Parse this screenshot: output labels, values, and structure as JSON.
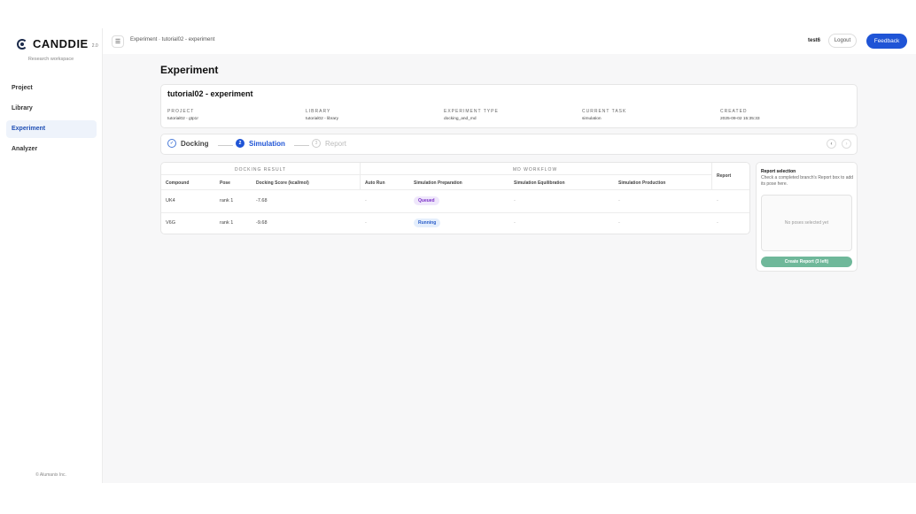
{
  "brand": {
    "name": "CANDDIE",
    "version": "2.0",
    "subtitle": "Research workspace"
  },
  "sidebar": {
    "items": [
      {
        "label": "Project"
      },
      {
        "label": "Library"
      },
      {
        "label": "Experiment"
      },
      {
        "label": "Analyzer"
      }
    ],
    "active": "Experiment",
    "copyright": "© Alumanix Inc."
  },
  "topbar": {
    "breadcrumb": "Experiment · tutorial02 - experiment",
    "user": "test6",
    "logout_label": "Logout",
    "feedback_label": "Feedback"
  },
  "page": {
    "title": "Experiment"
  },
  "experiment": {
    "name": "tutorial02 - experiment",
    "fields": [
      {
        "label": "PROJECT",
        "value": "tutorial02 - gtp1r"
      },
      {
        "label": "LIBRARY",
        "value": "tutorial02 - library"
      },
      {
        "label": "EXPERIMENT TYPE",
        "value": "docking_and_md"
      },
      {
        "label": "CURRENT TASK",
        "value": "simulation"
      },
      {
        "label": "CREATED",
        "value": "2025-09-02 15:35:33"
      }
    ]
  },
  "stepper": {
    "steps": [
      {
        "label": "Docking",
        "state": "done",
        "marker": "✓"
      },
      {
        "label": "Simulation",
        "state": "active",
        "marker": "2"
      },
      {
        "label": "Report",
        "state": "pending",
        "marker": "3"
      }
    ]
  },
  "table": {
    "groups": {
      "docking": "DOCKING RESULT",
      "md": "MD WORKFLOW",
      "report": "Report"
    },
    "columns": [
      "Compound",
      "Pose",
      "Docking Score (kcal/mol)",
      "Auto Run",
      "Simulation Preparation",
      "Simulation Equilibration",
      "Simulation Production"
    ],
    "rows": [
      {
        "compound": "UK4",
        "pose": "rank 1",
        "score": "-7.68",
        "auto_run": "-",
        "prep": "Queued",
        "equil": "-",
        "prod": "-",
        "report": "-"
      },
      {
        "compound": "V6G",
        "pose": "rank 1",
        "score": "-9.68",
        "auto_run": "-",
        "prep": "Running",
        "equil": "-",
        "prod": "-",
        "report": "-"
      }
    ]
  },
  "report_panel": {
    "title": "Report selection",
    "description": "Check a completed branch's Report box to add its pose here.",
    "empty": "No poses selected yet",
    "button_label": "Create Report (3 left)"
  },
  "colors": {
    "accent": "#1f54d6",
    "queued_bg": "#efe7fb",
    "queued_fg": "#7a2fc7",
    "running_bg": "#e4eefc",
    "running_fg": "#2a5cc8",
    "create_btn": "#6fb89a"
  }
}
